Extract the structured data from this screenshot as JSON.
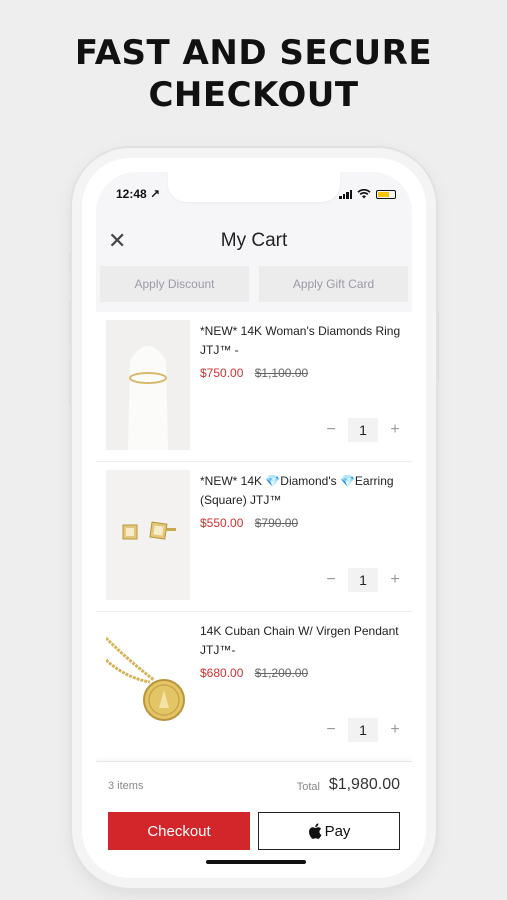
{
  "headline": {
    "line1": "FAST AND SECURE",
    "line2": "CHECKOUT"
  },
  "status_bar": {
    "time": "12:48 ↗"
  },
  "cart": {
    "title": "My Cart",
    "close_icon": "close-icon",
    "apply_discount": "Apply Discount",
    "apply_gift_card": "Apply Gift Card"
  },
  "items": [
    {
      "name": "*NEW* 14K Woman's Diamonds Ring JTJ™ -",
      "sale_price": "$750.00",
      "original_price": "$1,100.00",
      "quantity": "1",
      "image": "ring-photo"
    },
    {
      "name": "*NEW* 14K 💎Diamond's 💎Earring (Square) JTJ™",
      "sale_price": "$550.00",
      "original_price": "$790.00",
      "quantity": "1",
      "image": "earring-photo"
    },
    {
      "name": "14K Cuban Chain W/ Virgen Pendant JTJ™-",
      "sale_price": "$680.00",
      "original_price": "$1,200.00",
      "quantity": "1",
      "image": "pendant-photo"
    }
  ],
  "qty_controls": {
    "minus": "−",
    "plus": "+"
  },
  "summary": {
    "items_count": "3 items",
    "total_label": "Total",
    "total_value": "$1,980.00"
  },
  "actions": {
    "checkout": "Checkout",
    "apple_pay": "Pay"
  },
  "colors": {
    "accent_red": "#d3262a",
    "sale_red": "#d03131",
    "battery_yellow": "#f5c400"
  }
}
